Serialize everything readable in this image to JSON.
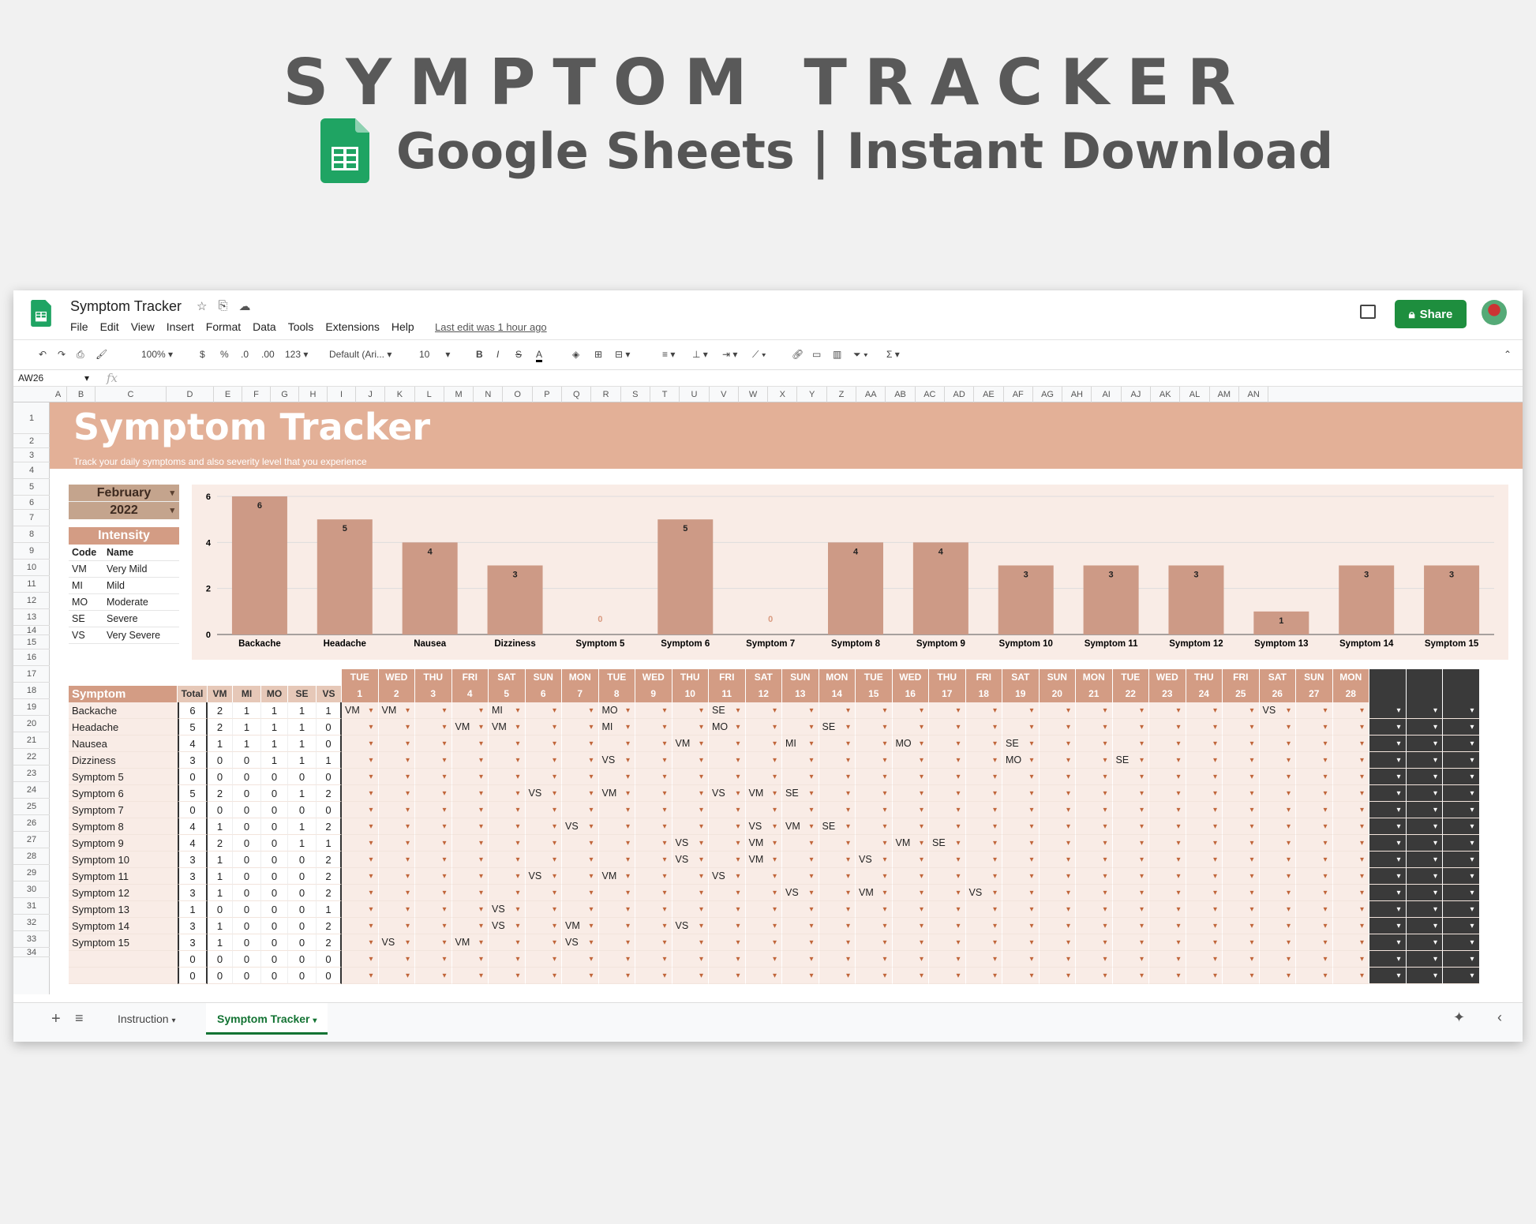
{
  "hero": {
    "title": "SYMPTOM TRACKER",
    "subtitle": "Google Sheets | Instant Download"
  },
  "app": {
    "doc_title": "Symptom Tracker",
    "menu": [
      "File",
      "Edit",
      "View",
      "Insert",
      "Format",
      "Data",
      "Tools",
      "Extensions",
      "Help"
    ],
    "last_edit": "Last edit was 1 hour ago",
    "share_label": "Share",
    "toolbar": {
      "zoom": "100%",
      "currency": "$",
      "percent": "%",
      "dec_less": ".0",
      "dec_more": ".00",
      "format_123": "123",
      "font": "Default (Ari...",
      "font_size": "10"
    },
    "name_box": "AW26",
    "fx": "fx",
    "columns": [
      "A",
      "B",
      "C",
      "D",
      "E",
      "F",
      "G",
      "H",
      "I",
      "J",
      "K",
      "L",
      "M",
      "N",
      "O",
      "P",
      "Q",
      "R",
      "S",
      "T",
      "U",
      "V",
      "W",
      "X",
      "Y",
      "Z",
      "AA",
      "AB",
      "AC",
      "AD",
      "AE",
      "AF",
      "AG",
      "AH",
      "AI",
      "AJ",
      "AK",
      "AL",
      "AM",
      "AN"
    ],
    "rows": [
      "1",
      "2",
      "3",
      "4",
      "5",
      "6",
      "7",
      "8",
      "9",
      "10",
      "11",
      "12",
      "13",
      "14",
      "15",
      "16",
      "17",
      "18",
      "19",
      "20",
      "21",
      "22",
      "23",
      "24",
      "25",
      "26",
      "27",
      "28",
      "29",
      "30",
      "31",
      "32",
      "33",
      "34"
    ],
    "tabs": {
      "instruction": "Instruction",
      "active": "Symptom Tracker"
    }
  },
  "sheet": {
    "banner_title": "Symptom Tracker",
    "banner_sub": "Track your daily symptoms and also severity level that you experience",
    "month": "February",
    "year": "2022",
    "intensity": {
      "title": "Intensity",
      "header": [
        "Code",
        "Name"
      ],
      "rows": [
        [
          "VM",
          "Very Mild"
        ],
        [
          "MI",
          "Mild"
        ],
        [
          "MO",
          "Moderate"
        ],
        [
          "SE",
          "Severe"
        ],
        [
          "VS",
          "Very Severe"
        ]
      ]
    },
    "table_headers": {
      "symptom": "Symptom",
      "total": "Total",
      "codes": [
        "VM",
        "MI",
        "MO",
        "SE",
        "VS"
      ]
    },
    "weekdays": [
      "TUE",
      "WED",
      "THU",
      "FRI",
      "SAT",
      "SUN",
      "MON",
      "TUE",
      "WED",
      "THU",
      "FRI",
      "SAT",
      "SUN",
      "MON",
      "TUE",
      "WED",
      "THU",
      "FRI",
      "SAT",
      "SUN",
      "MON",
      "TUE",
      "WED",
      "THU",
      "FRI",
      "SAT",
      "SUN",
      "MON"
    ],
    "days": [
      "1",
      "2",
      "3",
      "4",
      "5",
      "6",
      "7",
      "8",
      "9",
      "10",
      "11",
      "12",
      "13",
      "14",
      "15",
      "16",
      "17",
      "18",
      "19",
      "20",
      "21",
      "22",
      "23",
      "24",
      "25",
      "26",
      "27",
      "28"
    ],
    "symptoms": [
      {
        "name": "Backache",
        "counts": [
          "6",
          "2",
          "1",
          "1",
          "1",
          "1"
        ],
        "entries": {
          "1": "VM",
          "2": "VM",
          "5": "MI",
          "8": "MO",
          "11": "SE",
          "26": "VS"
        }
      },
      {
        "name": "Headache",
        "counts": [
          "5",
          "2",
          "1",
          "1",
          "1",
          "0"
        ],
        "entries": {
          "4": "VM",
          "5": "VM",
          "8": "MI",
          "11": "MO",
          "14": "SE"
        }
      },
      {
        "name": "Nausea",
        "counts": [
          "4",
          "1",
          "1",
          "1",
          "1",
          "0"
        ],
        "entries": {
          "10": "VM",
          "13": "MI",
          "16": "MO",
          "19": "SE"
        }
      },
      {
        "name": "Dizziness",
        "counts": [
          "3",
          "0",
          "0",
          "1",
          "1",
          "1"
        ],
        "entries": {
          "8": "VS",
          "19": "MO",
          "22": "SE"
        }
      },
      {
        "name": "Symptom 5",
        "counts": [
          "0",
          "0",
          "0",
          "0",
          "0",
          "0"
        ],
        "entries": {}
      },
      {
        "name": "Symptom 6",
        "counts": [
          "5",
          "2",
          "0",
          "0",
          "1",
          "2"
        ],
        "entries": {
          "6": "VS",
          "8": "VM",
          "11": "VS",
          "12": "VM",
          "13": "SE"
        }
      },
      {
        "name": "Symptom 7",
        "counts": [
          "0",
          "0",
          "0",
          "0",
          "0",
          "0"
        ],
        "entries": {}
      },
      {
        "name": "Symptom 8",
        "counts": [
          "4",
          "1",
          "0",
          "0",
          "1",
          "2"
        ],
        "entries": {
          "7": "VS",
          "12": "VS",
          "13": "VM",
          "14": "SE"
        }
      },
      {
        "name": "Symptom 9",
        "counts": [
          "4",
          "2",
          "0",
          "0",
          "1",
          "1"
        ],
        "entries": {
          "10": "VS",
          "12": "VM",
          "16": "VM",
          "17": "SE"
        }
      },
      {
        "name": "Symptom 10",
        "counts": [
          "3",
          "1",
          "0",
          "0",
          "0",
          "2"
        ],
        "entries": {
          "10": "VS",
          "12": "VM",
          "15": "VS"
        }
      },
      {
        "name": "Symptom 11",
        "counts": [
          "3",
          "1",
          "0",
          "0",
          "0",
          "2"
        ],
        "entries": {
          "6": "VS",
          "8": "VM",
          "11": "VS"
        }
      },
      {
        "name": "Symptom 12",
        "counts": [
          "3",
          "1",
          "0",
          "0",
          "0",
          "2"
        ],
        "entries": {
          "13": "VS",
          "15": "VM",
          "18": "VS"
        }
      },
      {
        "name": "Symptom 13",
        "counts": [
          "1",
          "0",
          "0",
          "0",
          "0",
          "1"
        ],
        "entries": {
          "5": "VS"
        }
      },
      {
        "name": "Symptom 14",
        "counts": [
          "3",
          "1",
          "0",
          "0",
          "0",
          "2"
        ],
        "entries": {
          "5": "VS",
          "7": "VM",
          "10": "VS"
        }
      },
      {
        "name": "Symptom 15",
        "counts": [
          "3",
          "1",
          "0",
          "0",
          "0",
          "2"
        ],
        "entries": {
          "2": "VS",
          "4": "VM",
          "7": "VS"
        }
      },
      {
        "name": "",
        "counts": [
          "0",
          "0",
          "0",
          "0",
          "0",
          "0"
        ],
        "entries": {}
      },
      {
        "name": "",
        "counts": [
          "0",
          "0",
          "0",
          "0",
          "0",
          "0"
        ],
        "entries": {}
      }
    ]
  },
  "chart_data": {
    "type": "bar",
    "categories": [
      "Backache",
      "Headache",
      "Nausea",
      "Dizziness",
      "Symptom 5",
      "Symptom 6",
      "Symptom 7",
      "Symptom 8",
      "Symptom 9",
      "Symptom 10",
      "Symptom 11",
      "Symptom 12",
      "Symptom 13",
      "Symptom 14",
      "Symptom 15"
    ],
    "values": [
      6,
      5,
      4,
      3,
      0,
      5,
      0,
      4,
      4,
      3,
      3,
      3,
      1,
      3,
      3
    ],
    "yticks": [
      0,
      2,
      4,
      6
    ],
    "ylim": [
      0,
      6
    ],
    "grid": true,
    "bar_color": "#cd9a86",
    "zero_label_color": "#d99a80"
  }
}
